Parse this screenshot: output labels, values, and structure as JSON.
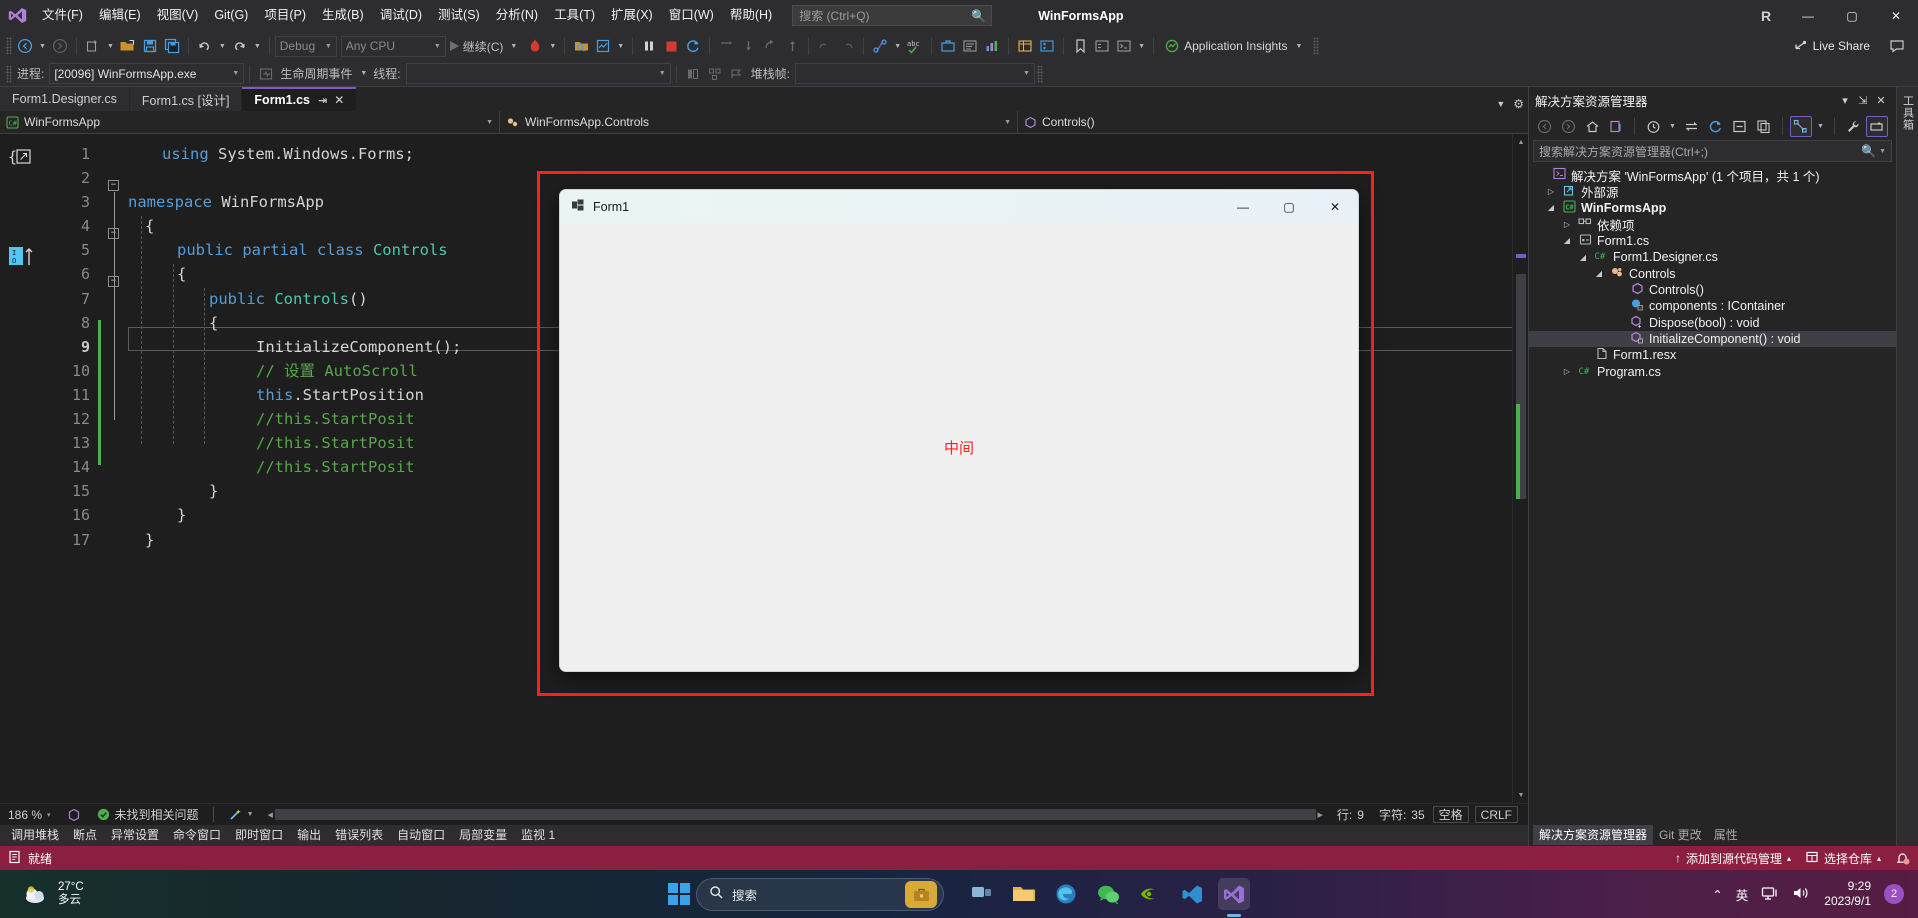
{
  "titlebar": {
    "logo_icon": "visual-studio-logo",
    "menus": [
      {
        "label": "文件(F)"
      },
      {
        "label": "编辑(E)"
      },
      {
        "label": "视图(V)"
      },
      {
        "label": "Git(G)"
      },
      {
        "label": "项目(P)"
      },
      {
        "label": "生成(B)"
      },
      {
        "label": "调试(D)"
      },
      {
        "label": "测试(S)"
      },
      {
        "label": "分析(N)"
      },
      {
        "label": "工具(T)"
      },
      {
        "label": "扩展(X)"
      },
      {
        "label": "窗口(W)"
      },
      {
        "label": "帮助(H)"
      }
    ],
    "search_placeholder": "搜索 (Ctrl+Q)",
    "search_icon": "search-icon",
    "app_title": "WinFormsApp",
    "account_initial": "R",
    "minimize": "—",
    "maximize": "▢",
    "close": "✕"
  },
  "toolbar": {
    "nav_back": "◀",
    "nav_forward": "▶",
    "new_project": "new-project-icon",
    "open_file": "open-file-icon",
    "save": "save-icon",
    "save_all": "save-all-icon",
    "undo": "undo-icon",
    "redo": "redo-icon",
    "config": "Debug",
    "platform": "Any CPU",
    "run_label": "继续(C)",
    "hot_reload": "hot-reload-icon",
    "app_insights": "Application Insights",
    "live_share": "Live Share",
    "pause": "pause-icon",
    "stop": "stop-icon",
    "restart": "restart-icon",
    "step_into": "step-into-icon",
    "step_over": "step-over-icon",
    "step_out": "step-out-icon"
  },
  "debugbar": {
    "process_label": "进程:",
    "process_value": "[20096] WinFormsApp.exe",
    "lifecycle_label": "生命周期事件",
    "thread_label": "线程:",
    "thread_value": "",
    "stack_label": "堆栈帧:",
    "stack_value": ""
  },
  "tabs": [
    {
      "label": "Form1.Designer.cs",
      "active": false
    },
    {
      "label": "Form1.cs [设计]",
      "active": false
    },
    {
      "label": "Form1.cs",
      "active": true,
      "pin": "⇥",
      "close": "✕"
    }
  ],
  "navbar": {
    "project": "WinFormsApp",
    "project_icon": "csharp-project-icon",
    "type": "WinFormsApp.Controls",
    "type_icon": "class-icon",
    "member": "Controls()",
    "member_icon": "method-icon",
    "dropdown": "▾"
  },
  "editor": {
    "line_numbers": [
      "1",
      "2",
      "3",
      "4",
      "5",
      "6",
      "7",
      "8",
      "9",
      "10",
      "11",
      "12",
      "13",
      "14",
      "15",
      "16",
      "17"
    ],
    "current_line": 9,
    "lines": [
      {
        "n": 1,
        "tokens": [
          {
            "t": "using ",
            "c": "kw"
          },
          {
            "t": "System.Windows.Forms;",
            "c": "id"
          }
        ],
        "indent": 0
      },
      {
        "n": 2,
        "tokens": [],
        "indent": 0
      },
      {
        "n": 3,
        "tokens": [
          {
            "t": "namespace ",
            "c": "kw"
          },
          {
            "t": "WinFormsApp",
            "c": "id"
          }
        ],
        "indent": 0
      },
      {
        "n": 4,
        "tokens": [
          {
            "t": "{",
            "c": "id"
          }
        ],
        "indent": 1
      },
      {
        "n": 5,
        "tokens": [
          {
            "t": "public partial class ",
            "c": "kw"
          },
          {
            "t": "Controls",
            "c": "type"
          }
        ],
        "indent": 2
      },
      {
        "n": 6,
        "tokens": [
          {
            "t": "{",
            "c": "id"
          }
        ],
        "indent": 2
      },
      {
        "n": 7,
        "tokens": [
          {
            "t": "public ",
            "c": "kw"
          },
          {
            "t": "Controls",
            "c": "type"
          },
          {
            "t": "()",
            "c": "id"
          }
        ],
        "indent": 3
      },
      {
        "n": 8,
        "tokens": [
          {
            "t": "{",
            "c": "id"
          }
        ],
        "indent": 3
      },
      {
        "n": 9,
        "tokens": [
          {
            "t": "InitializeComponent();",
            "c": "id"
          }
        ],
        "indent": 4
      },
      {
        "n": 10,
        "tokens": [
          {
            "t": "// 设置 AutoScroll",
            "c": "cmt"
          }
        ],
        "indent": 4
      },
      {
        "n": 11,
        "tokens": [
          {
            "t": "this",
            "c": "kw"
          },
          {
            "t": ".StartPosition",
            "c": "id"
          }
        ],
        "indent": 4
      },
      {
        "n": 12,
        "tokens": [
          {
            "t": "//this.StartPosit",
            "c": "cmt"
          }
        ],
        "indent": 4
      },
      {
        "n": 13,
        "tokens": [
          {
            "t": "//this.StartPosit",
            "c": "cmt"
          }
        ],
        "indent": 4
      },
      {
        "n": 14,
        "tokens": [
          {
            "t": "//this.StartPosit",
            "c": "cmt"
          }
        ],
        "indent": 4
      },
      {
        "n": 15,
        "tokens": [
          {
            "t": "}",
            "c": "id"
          }
        ],
        "indent": 3
      },
      {
        "n": 16,
        "tokens": [
          {
            "t": "}",
            "c": "id"
          }
        ],
        "indent": 2
      },
      {
        "n": 17,
        "tokens": [
          {
            "t": "}",
            "c": "id"
          }
        ],
        "indent": 1
      }
    ],
    "bookmark_icon": "bookmark-brace-icon",
    "ioglyph_icon": "io-arrow-icon"
  },
  "form1": {
    "title": "Form1",
    "icon": "winforms-icon",
    "minimize": "—",
    "maximize": "▢",
    "close": "✕",
    "content_label": "中间",
    "content_color": "#ff2020",
    "highlight_color": "#ff2020"
  },
  "solution_explorer": {
    "title": "解决方案资源管理器",
    "header_dropdown": "▾",
    "header_pin": "⇲",
    "header_close": "✕",
    "toolbar_icons": [
      {
        "name": "back-icon",
        "glyph": "⬅"
      },
      {
        "name": "forward-icon",
        "glyph": "➡"
      },
      {
        "name": "home-icon",
        "glyph": "⌂"
      },
      {
        "name": "pending-changes-icon",
        "glyph": "⧉"
      },
      {
        "name": "history-icon",
        "glyph": "⏱"
      },
      {
        "name": "sync-icon",
        "glyph": "⇆"
      },
      {
        "name": "refresh-icon",
        "glyph": "⟳"
      },
      {
        "name": "collapse-all-icon",
        "glyph": "⊟"
      },
      {
        "name": "show-all-files-icon",
        "glyph": "⧉"
      },
      {
        "name": "view-hierarchy-icon",
        "glyph": "⛓"
      },
      {
        "name": "properties-wrench-icon",
        "glyph": "🔧"
      },
      {
        "name": "preview-selected-icon",
        "glyph": "▤"
      }
    ],
    "search_placeholder": "搜索解决方案资源管理器(Ctrl+;)",
    "search_icon": "search-icon",
    "tree": [
      {
        "indent": 0,
        "exp": "",
        "icon": "solution-icon",
        "glyph": "▤",
        "label": "解决方案 'WinFormsApp' (1 个项目，共 1 个)",
        "bold": false,
        "sel": false,
        "color": "#f1f1f1"
      },
      {
        "indent": 0,
        "exp": "▷",
        "icon": "external-sources-icon",
        "glyph": "🗗",
        "label": "外部源",
        "bold": false,
        "sel": false,
        "color": "#f1f1f1"
      },
      {
        "indent": 0,
        "exp": "◢",
        "icon": "csharp-project-icon",
        "glyph": "C#",
        "label": "WinFormsApp",
        "bold": true,
        "sel": false,
        "color": "#f1f1f1"
      },
      {
        "indent": 1,
        "exp": "▷",
        "icon": "dependencies-icon",
        "glyph": "🗄",
        "label": "依赖项",
        "bold": false,
        "sel": false,
        "color": "#f1f1f1"
      },
      {
        "indent": 1,
        "exp": "◢",
        "icon": "form-icon",
        "glyph": "▣",
        "label": "Form1.cs",
        "bold": false,
        "sel": false,
        "color": "#f1f1f1"
      },
      {
        "indent": 2,
        "exp": "◢",
        "icon": "csharp-file-icon",
        "glyph": "C#",
        "label": "Form1.Designer.cs",
        "bold": false,
        "sel": false,
        "color": "#f1f1f1"
      },
      {
        "indent": 3,
        "exp": "◢",
        "icon": "class-icon",
        "glyph": "✿",
        "label": "Controls",
        "bold": false,
        "sel": false,
        "color": "#f1f1f1"
      },
      {
        "indent": 4,
        "exp": "",
        "icon": "method-icon",
        "glyph": "◈",
        "label": "Controls()",
        "bold": false,
        "sel": false,
        "color": "#f1f1f1"
      },
      {
        "indent": 4,
        "exp": "",
        "icon": "field-icon",
        "glyph": "◕",
        "label": "components : IContainer",
        "bold": false,
        "sel": false,
        "color": "#f1f1f1"
      },
      {
        "indent": 4,
        "exp": "",
        "icon": "method-icon",
        "glyph": "◈",
        "label": "Dispose(bool) : void",
        "bold": false,
        "sel": false,
        "color": "#f1f1f1"
      },
      {
        "indent": 4,
        "exp": "",
        "icon": "method-icon",
        "glyph": "◈",
        "label": "InitializeComponent() : void",
        "bold": false,
        "sel": true,
        "color": "#f1f1f1"
      },
      {
        "indent": 2,
        "exp": "",
        "icon": "resx-icon",
        "glyph": "🗋",
        "label": "Form1.resx",
        "bold": false,
        "sel": false,
        "color": "#f1f1f1"
      },
      {
        "indent": 1,
        "exp": "▷",
        "icon": "csharp-file-icon",
        "glyph": "C#",
        "label": "Program.cs",
        "bold": false,
        "sel": false,
        "color": "#f1f1f1"
      }
    ],
    "bottom_tabs": [
      {
        "label": "解决方案资源管理器",
        "active": true
      },
      {
        "label": "Git 更改",
        "active": false
      },
      {
        "label": "属性",
        "active": false
      }
    ],
    "vertical_tool": "工具箱"
  },
  "editor_status": {
    "zoom": "186 %",
    "zoom_caret": "▾",
    "issues_icon": "check-circle-icon",
    "issues": "未找到相关问题",
    "wand_icon": "magic-wand-icon",
    "line_label": "行:",
    "line_value": "9",
    "char_label": "字符:",
    "char_value": "35",
    "spaces": "空格",
    "eol": "CRLF"
  },
  "debug_tabs": [
    {
      "label": "调用堆栈"
    },
    {
      "label": "断点"
    },
    {
      "label": "异常设置"
    },
    {
      "label": "命令窗口"
    },
    {
      "label": "即时窗口"
    },
    {
      "label": "输出"
    },
    {
      "label": "错误列表"
    },
    {
      "label": "自动窗口"
    },
    {
      "label": "局部变量"
    },
    {
      "label": "监视 1"
    }
  ],
  "vs_statusbar": {
    "ready_icon": "ready-icon",
    "ready": "就绪",
    "source_control": "添加到源代码管理",
    "source_control_caret": "▴",
    "repo_icon": "repo-icon",
    "repo": "选择仓库",
    "repo_caret": "▴",
    "bell_icon": "bell-icon",
    "bg_color": "#8b1f41"
  },
  "taskbar": {
    "weather_temp": "27°C",
    "weather_desc": "多云",
    "weather_icon": "cloud-icon",
    "start_icon": "windows-start-icon",
    "search_placeholder": "搜索",
    "search_icon": "search-icon",
    "search_pill_icon": "briefcase-icon",
    "apps": [
      {
        "name": "taskview-icon",
        "glyph": "▤",
        "color": "#8fb8d8",
        "active": false
      },
      {
        "name": "file-explorer-icon",
        "glyph": "🗀",
        "color": "#e8b34a",
        "active": false
      },
      {
        "name": "edge-icon",
        "glyph": "◉",
        "color": "#3aa2e8",
        "active": false
      },
      {
        "name": "wechat-icon",
        "glyph": "◍",
        "color": "#4fc35a",
        "active": false
      },
      {
        "name": "nvidia-icon",
        "glyph": "N",
        "color": "#7bbf3a",
        "active": false
      },
      {
        "name": "vscode-icon",
        "glyph": "◂",
        "color": "#3aa2e8",
        "active": false
      },
      {
        "name": "visual-studio-icon",
        "glyph": "◆",
        "color": "#9a6fd8",
        "active": true
      }
    ],
    "tray_expand": "⌃",
    "ime": "英",
    "network_icon": "network-icon",
    "volume_icon": "volume-icon",
    "time": "9:29",
    "date": "2023/9/1",
    "notification_count": "2"
  }
}
